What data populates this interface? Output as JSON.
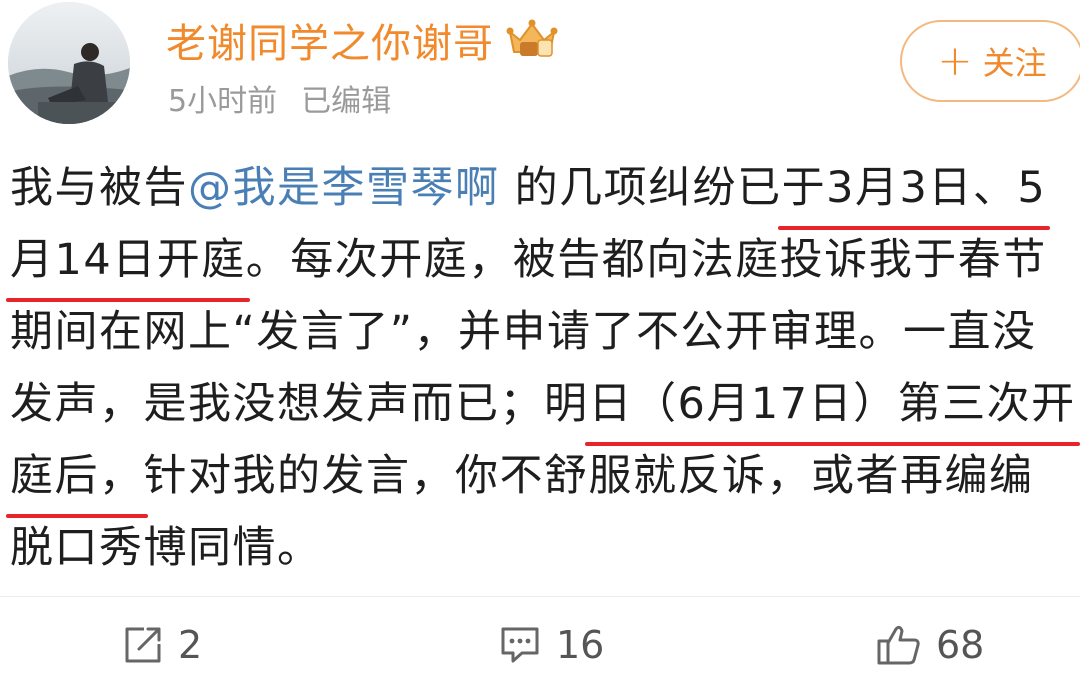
{
  "post": {
    "author": {
      "name": "老谢同学之你谢哥",
      "badge_icon": "vip-crown-icon"
    },
    "meta": {
      "time": "5小时前",
      "edited": "已编辑"
    },
    "follow_button": {
      "icon": "plus-icon",
      "label": "关注"
    },
    "content": {
      "line1": {
        "pre": "我与被告",
        "mention": "@我是李雪琴啊",
        "mid": " 的几项纠纷已",
        "underlined": "于3月3日、5"
      },
      "line2": {
        "underlined": "月14日开庭",
        "post": "。每次开庭，被告都向法庭投诉我于春节"
      },
      "line3": {
        "text": "期间在网上“发言了”，并申请了不公开审理。一直没"
      },
      "line4": {
        "pre": "发声，是我没想发声而已；明",
        "underlined": "日（6月17日）第三次开"
      },
      "line5": {
        "underlined": "庭后，",
        "post": "针对我的发言，你不舒服就反诉，或者再编编"
      },
      "line6": {
        "text": "脱口秀博同情。"
      }
    },
    "actions": {
      "share": {
        "icon": "share-icon",
        "count": "2"
      },
      "comment": {
        "icon": "comment-icon",
        "count": "16"
      },
      "like": {
        "icon": "thumbs-up-icon",
        "count": "68"
      }
    }
  },
  "colors": {
    "username": "#f08a2c",
    "mention": "#4a7fb5",
    "underline": "#e8232a",
    "meta": "#9a9a9a"
  }
}
